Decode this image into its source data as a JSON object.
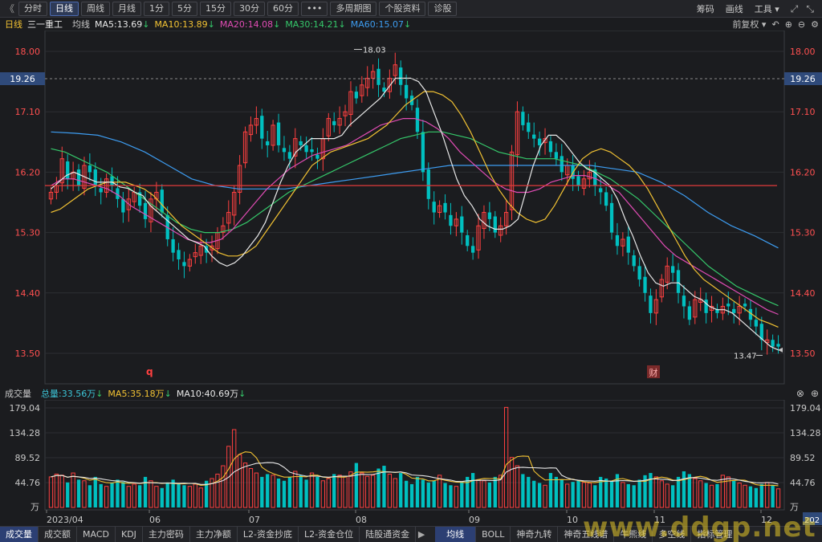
{
  "toolbar": {
    "nav_back": "《",
    "buttons": [
      "分时",
      "日线",
      "周线",
      "月线",
      "1分",
      "5分",
      "15分",
      "30分",
      "60分",
      "•••",
      "多周期图",
      "个股资料",
      "诊股"
    ],
    "active_index": 1,
    "right_items": [
      "筹码",
      "画线",
      "工具"
    ],
    "right_icons": [
      "expand-icon",
      "close-icon"
    ]
  },
  "ma_legend": {
    "period": "日线",
    "stock": "三一重工",
    "avg": "均线",
    "items": [
      {
        "label": "MA5:13.69",
        "arrow": "↓",
        "color": "#e8e8e8"
      },
      {
        "label": "MA10:13.89",
        "arrow": "↓",
        "color": "#f2c233"
      },
      {
        "label": "MA20:14.08",
        "arrow": "↓",
        "color": "#e04cb4"
      },
      {
        "label": "MA30:14.21",
        "arrow": "↓",
        "color": "#35c76a"
      },
      {
        "label": "MA60:15.07",
        "arrow": "↓",
        "color": "#3d9cf0"
      }
    ],
    "right": "前复权"
  },
  "price_axis": {
    "ticks": [
      "18.00",
      "17.10",
      "16.20",
      "15.30",
      "14.40",
      "13.50"
    ],
    "ref_price": "19.26",
    "high_label": "18.03",
    "low_label": "13.47"
  },
  "markers": {
    "q": "q",
    "cai": "财"
  },
  "volume_header": {
    "title": "成交量",
    "total": "总量:33.56万",
    "total_arrow": "↓",
    "ma5": "MA5:35.18万",
    "ma5_arrow": "↓",
    "ma10": "MA10:40.69万",
    "ma10_arrow": "↓"
  },
  "volume_axis": {
    "ticks": [
      "179.04",
      "134.28",
      "89.52",
      "44.76"
    ],
    "unit": "万"
  },
  "x_axis": {
    "labels": [
      "2023/04",
      "06",
      "07",
      "08",
      "09",
      "10",
      "11",
      "12"
    ],
    "right_tag": "202"
  },
  "tabs": {
    "left": [
      "成交量",
      "成交额",
      "MACD",
      "KDJ",
      "主力密码",
      "主力净额",
      "L2-资金抄底",
      "L2-资金仓位",
      "陆股通资金"
    ],
    "right": [
      "均线",
      "BOLL",
      "神奇九转",
      "神奇五线谱",
      "牛熊线",
      "多空线",
      "指标管理"
    ]
  },
  "watermark": "www.ddgp.net",
  "colors": {
    "up": "#ff4040",
    "down": "#00c0c0",
    "background": "#1b1c1f"
  },
  "chart_data": {
    "type": "candlestick",
    "title": "",
    "xlabel": "",
    "ylabel": "",
    "ylim": [
      13.3,
      18.3
    ],
    "y_ticks": [
      18.0,
      17.1,
      16.2,
      15.3,
      14.4,
      13.5
    ],
    "ref_lines": [
      16.0
    ],
    "annotations": [
      {
        "text": "18.03",
        "y": 18.03
      },
      {
        "text": "13.47",
        "y": 13.47
      }
    ],
    "months": [
      "2023/04",
      "06",
      "07",
      "08",
      "09",
      "10",
      "11",
      "12"
    ],
    "closes": [
      15.9,
      16.0,
      16.4,
      16.1,
      16.2,
      16.0,
      16.3,
      16.2,
      16.0,
      15.9,
      16.1,
      16.0,
      15.8,
      15.6,
      15.8,
      15.9,
      15.7,
      15.5,
      15.8,
      15.9,
      15.6,
      15.2,
      15.0,
      14.9,
      14.8,
      14.9,
      15.0,
      15.1,
      15.0,
      15.1,
      15.3,
      15.4,
      15.6,
      15.9,
      16.3,
      16.8,
      16.9,
      17.0,
      16.7,
      16.6,
      16.9,
      16.6,
      16.5,
      16.4,
      16.7,
      16.6,
      16.5,
      16.5,
      16.4,
      16.7,
      17.0,
      16.9,
      17.0,
      17.1,
      17.4,
      17.3,
      17.5,
      17.6,
      17.7,
      17.5,
      17.4,
      17.6,
      17.8,
      17.5,
      17.3,
      17.2,
      16.8,
      16.2,
      15.8,
      15.6,
      15.7,
      15.6,
      15.4,
      15.5,
      15.3,
      15.1,
      15.0,
      15.4,
      15.6,
      15.5,
      15.3,
      15.4,
      15.6,
      16.5,
      17.1,
      16.9,
      16.8,
      16.7,
      16.6,
      16.7,
      16.5,
      16.4,
      16.2,
      16.3,
      16.1,
      16.0,
      16.1,
      16.2,
      16.0,
      15.9,
      15.7,
      15.3,
      15.1,
      15.2,
      15.0,
      14.8,
      14.6,
      14.4,
      14.1,
      14.3,
      14.6,
      14.8,
      14.7,
      14.4,
      14.2,
      14.0,
      14.3,
      14.3,
      14.1,
      14.2,
      14.1,
      14.2,
      14.2,
      14.1,
      14.2,
      14.2,
      14.0,
      13.9,
      13.7,
      13.7,
      13.6,
      13.6
    ],
    "ma5": [
      15.95,
      16.05,
      16.15,
      16.2,
      16.15,
      16.1,
      16.05,
      16.05,
      16.05,
      15.98,
      15.96,
      15.9,
      15.85,
      15.7,
      15.6,
      15.5,
      15.4,
      15.3,
      15.2,
      15.15,
      15.1,
      14.95,
      14.85,
      14.8,
      14.85,
      14.95,
      15.1,
      15.25,
      15.45,
      15.75,
      16.05,
      16.3,
      16.5,
      16.6,
      16.7,
      16.7,
      16.7,
      16.7,
      16.75,
      16.9,
      17.0,
      17.1,
      17.2,
      17.3,
      17.45,
      17.6,
      17.6,
      17.6,
      17.55,
      17.4,
      17.1,
      16.8,
      16.45,
      16.1,
      15.85,
      15.7,
      15.5,
      15.4,
      15.35,
      15.35,
      15.4,
      15.5,
      15.9,
      16.3,
      16.6,
      16.75,
      16.75,
      16.65,
      16.5,
      16.35,
      16.25,
      16.2,
      16.1,
      16.0,
      15.8,
      15.5,
      15.25,
      14.95,
      14.7,
      14.55,
      14.5,
      14.55,
      14.55,
      14.45,
      14.35,
      14.3,
      14.2,
      14.15,
      14.15,
      14.1,
      14.0,
      13.9,
      13.8,
      13.7,
      13.6,
      13.55
    ],
    "ma10": [
      15.6,
      15.65,
      15.75,
      15.85,
      15.95,
      16.0,
      16.05,
      16.05,
      16.05,
      16.0,
      15.95,
      15.85,
      15.7,
      15.55,
      15.4,
      15.3,
      15.2,
      15.1,
      15.0,
      14.95,
      14.95,
      15.0,
      15.1,
      15.3,
      15.5,
      15.7,
      15.9,
      16.1,
      16.3,
      16.4,
      16.5,
      16.55,
      16.6,
      16.65,
      16.7,
      16.8,
      16.9,
      17.05,
      17.2,
      17.3,
      17.4,
      17.4,
      17.35,
      17.25,
      17.05,
      16.8,
      16.5,
      16.2,
      15.95,
      15.75,
      15.6,
      15.5,
      15.45,
      15.5,
      15.7,
      15.95,
      16.2,
      16.4,
      16.5,
      16.55,
      16.5,
      16.4,
      16.3,
      16.15,
      15.95,
      15.7,
      15.45,
      15.2,
      14.95,
      14.75,
      14.6,
      14.5,
      14.4,
      14.3,
      14.2,
      14.1,
      14.0,
      13.95,
      13.89
    ],
    "ma20": [
      16.0,
      16.1,
      16.1,
      16.05,
      16.0,
      15.95,
      15.85,
      15.7,
      15.6,
      15.5,
      15.4,
      15.3,
      15.2,
      15.15,
      15.15,
      15.2,
      15.35,
      15.55,
      15.75,
      15.95,
      16.1,
      16.25,
      16.35,
      16.45,
      16.5,
      16.55,
      16.6,
      16.7,
      16.8,
      16.9,
      16.95,
      17.0,
      17.0,
      16.95,
      16.85,
      16.7,
      16.5,
      16.35,
      16.2,
      16.05,
      15.95,
      15.9,
      15.9,
      15.95,
      16.05,
      16.1,
      16.15,
      16.15,
      16.1,
      16.0,
      15.9,
      15.7,
      15.5,
      15.3,
      15.1,
      14.95,
      14.85,
      14.75,
      14.65,
      14.55,
      14.45,
      14.35,
      14.25,
      14.15,
      14.08
    ],
    "ma30": [
      16.55,
      16.5,
      16.4,
      16.3,
      16.2,
      16.05,
      15.9,
      15.75,
      15.6,
      15.45,
      15.35,
      15.3,
      15.3,
      15.35,
      15.45,
      15.6,
      15.75,
      15.9,
      16.0,
      16.1,
      16.2,
      16.3,
      16.4,
      16.5,
      16.6,
      16.7,
      16.75,
      16.8,
      16.8,
      16.75,
      16.7,
      16.6,
      16.5,
      16.45,
      16.4,
      16.4,
      16.4,
      16.35,
      16.3,
      16.2,
      16.1,
      15.95,
      15.8,
      15.6,
      15.4,
      15.2,
      15.0,
      14.8,
      14.65,
      14.5,
      14.4,
      14.3,
      14.21
    ],
    "ma60": [
      16.8,
      16.78,
      16.75,
      16.65,
      16.5,
      16.3,
      16.1,
      16.0,
      15.95,
      15.95,
      15.95,
      16.0,
      16.05,
      16.1,
      16.15,
      16.2,
      16.25,
      16.3,
      16.3,
      16.3,
      16.3,
      16.3,
      16.3,
      16.3,
      16.25,
      16.2,
      16.05,
      15.85,
      15.6,
      15.4,
      15.25,
      15.07
    ],
    "volumes_wan": [
      55,
      60,
      58,
      45,
      62,
      50,
      48,
      40,
      55,
      42,
      38,
      45,
      50,
      46,
      38,
      42,
      40,
      55,
      48,
      38,
      35,
      45,
      50,
      44,
      40,
      38,
      42,
      35,
      48,
      52,
      60,
      75,
      110,
      140,
      95,
      80,
      70,
      62,
      55,
      60,
      58,
      52,
      48,
      55,
      65,
      58,
      50,
      62,
      55,
      48,
      52,
      60,
      58,
      55,
      64,
      80,
      62,
      56,
      58,
      70,
      75,
      60,
      52,
      62,
      48,
      42,
      55,
      50,
      45,
      48,
      58,
      44,
      40,
      38,
      46,
      55,
      62,
      50,
      48,
      45,
      55,
      58,
      180,
      90,
      75,
      60,
      55,
      48,
      44,
      40,
      62,
      55,
      50,
      42,
      46,
      48,
      45,
      44,
      40,
      55,
      52,
      48,
      60,
      45,
      42,
      40,
      50,
      58,
      62,
      55,
      48,
      42,
      40,
      55,
      65,
      60,
      52,
      48,
      44,
      40,
      42,
      58,
      55,
      48,
      44,
      40,
      38,
      35,
      42,
      45,
      40,
      33.56
    ],
    "volume_ylim": [
      0,
      179.04
    ],
    "volume_ticks": [
      179.04,
      134.28,
      89.52,
      44.76
    ]
  }
}
